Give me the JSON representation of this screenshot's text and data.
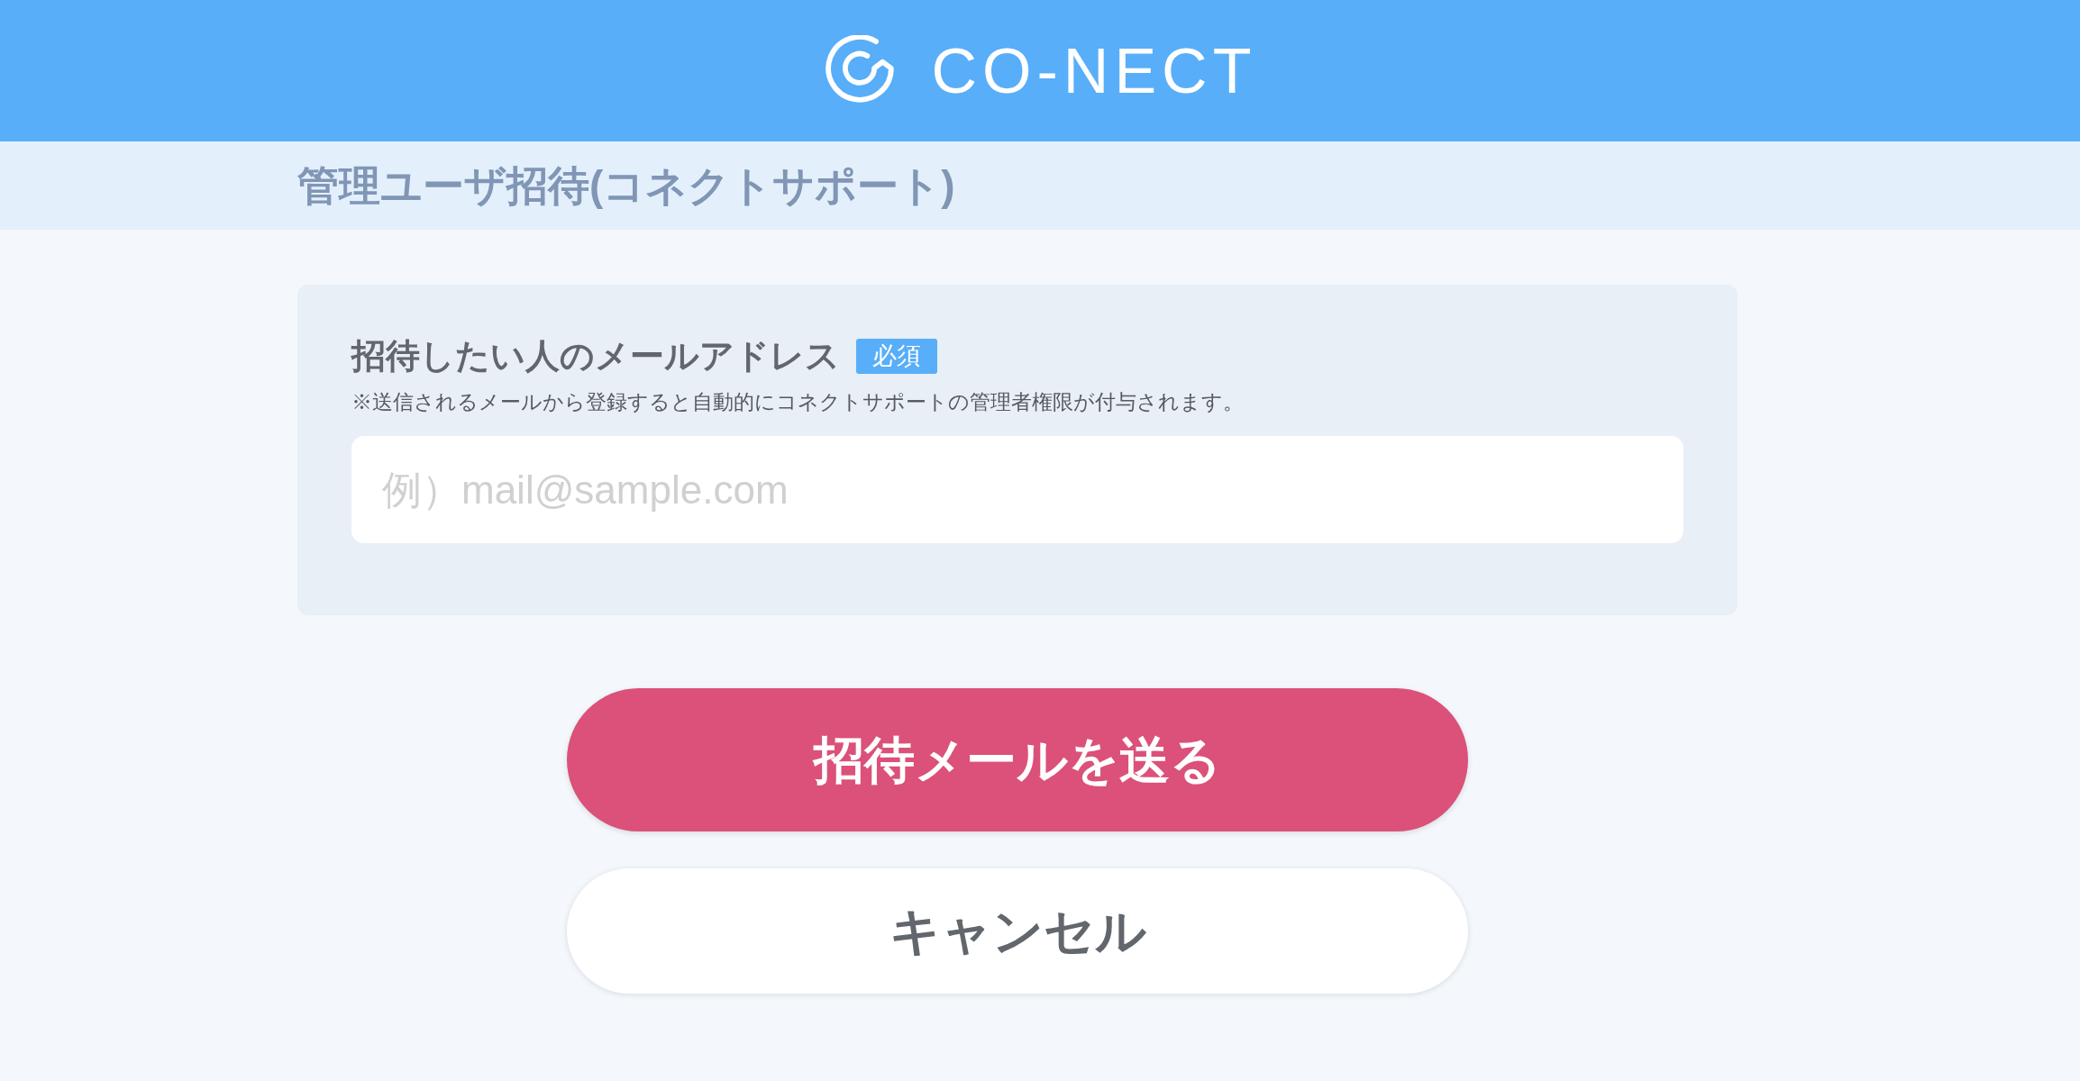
{
  "header": {
    "logo_text": "CO-NECT"
  },
  "page_title": "管理ユーザ招待(コネクトサポート)",
  "form": {
    "label": "招待したい人のメールアドレス",
    "required_badge": "必須",
    "note": "※送信されるメールから登録すると自動的にコネクトサポートの管理者権限が付与されます。",
    "email_field": {
      "placeholder": "例）mail@sample.com"
    }
  },
  "buttons": [
    {
      "kind": "primary",
      "label": "招待メールを送る"
    },
    {
      "kind": "secondary",
      "label": "キャンセル"
    }
  ]
}
